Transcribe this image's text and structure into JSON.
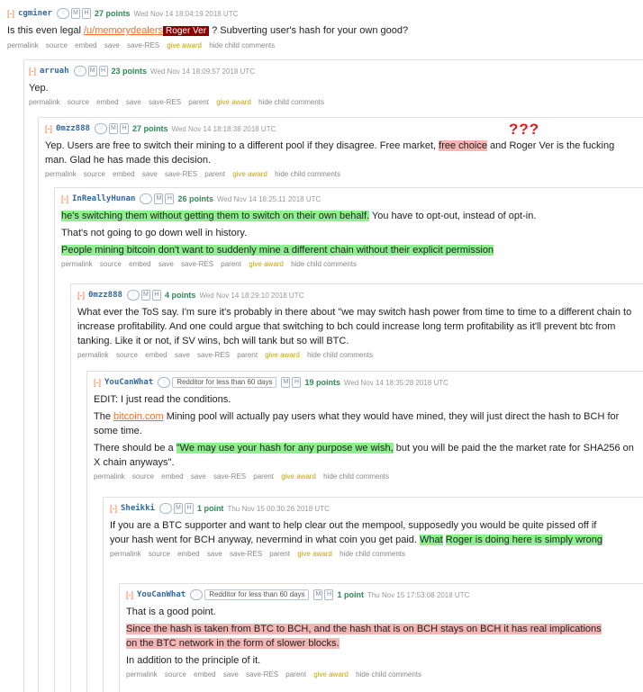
{
  "c1": {
    "toggle": "[-]",
    "author": "cgminer",
    "points": "27 points",
    "date": "Wed Nov 14 18:04:19 2018 UTC",
    "text_pre": "Is this even legal ",
    "user_link": "/u/memorydealers",
    "badge": "Roger Ver",
    "text_post": " ? Subverting user's hash for your own good?",
    "links": [
      "permalink",
      "source",
      "embed",
      "save",
      "save-RES",
      "give award",
      "hide child comments"
    ]
  },
  "c2": {
    "toggle": "[-]",
    "author": "arruah",
    "points": "23 points",
    "date": "Wed Nov 14 18:09:57 2018 UTC",
    "text": "Yep.",
    "links": [
      "permalink",
      "source",
      "embed",
      "save",
      "save-RES",
      "parent",
      "give award",
      "hide child comments"
    ]
  },
  "c3": {
    "toggle": "[-]",
    "author": "0mzz888",
    "points": "27 points",
    "date": "Wed Nov 14 18:18:38 2018 UTC",
    "text_pre": "Yep. Users are free to switch their mining to a different pool if they disagree. Free market, ",
    "hl": "free choice",
    "text_post": " and Roger Ver is the fucking man. Glad he has made this decision.",
    "annotation": "???",
    "links": [
      "permalink",
      "source",
      "embed",
      "save",
      "save-RES",
      "parent",
      "give award",
      "hide child comments"
    ]
  },
  "c4": {
    "toggle": "[-]",
    "author": "InReallyHunan",
    "points": "26 points",
    "date": "Wed Nov 14 18:25:11 2018 UTC",
    "hl1": "he's switching them without getting them to switch on their own behalf.",
    "text1": " You have to opt-out, instead of opt-in.",
    "text2": "That's not going to go down well in history.",
    "hl2": "People mining bitcoin don't want to suddenly mine a different chain without their explicit permission",
    "links": [
      "permalink",
      "source",
      "embed",
      "save",
      "save-RES",
      "parent",
      "give award",
      "hide child comments"
    ]
  },
  "c5": {
    "toggle": "[-]",
    "author": "0mzz888",
    "points": "4 points",
    "date": "Wed Nov 14 18:29:10 2018 UTC",
    "text": "What ever the ToS say. I'm sure it's probably in there about \"we may switch hash power from time to time to a different chain to increase profitability. And one could argue that switching to bch could increase long term profitability as it'll prevent btc from tanking. Like it or not, if SV wins, bch will tank but so will BTC.",
    "links": [
      "permalink",
      "source",
      "embed",
      "save",
      "save-RES",
      "parent",
      "give award",
      "hide child comments"
    ]
  },
  "c6": {
    "toggle": "[-]",
    "author": "YouCanWhat",
    "flair": "Redditor for less than 60 days",
    "points": "19 points",
    "date": "Wed Nov 14 18:35:28 2018 UTC",
    "text1": "EDIT: I just read the conditions.",
    "text2_pre": "The ",
    "link": "bitcoin.com",
    "text2_post": " Mining pool will actually pay users what they would have mined, they will just direct the hash to BCH for some time.",
    "text3_pre": "There should be a ",
    "hl": "\"We may use your hash for any purpose we wish,",
    "text3_post": " but you will be paid the the market rate for SHA256 on X chain anyways\".",
    "links": [
      "permalink",
      "source",
      "embed",
      "save",
      "save-RES",
      "parent",
      "give award",
      "hide child comments"
    ]
  },
  "c7": {
    "toggle": "[-]",
    "author": "Sheikki",
    "points": "1 point",
    "date": "Thu Nov 15 00:30:26 2018 UTC",
    "text_pre": "If you are a BTC supporter and want to help clear out the mempool, supposedly you would be quite pissed off if your hash went for BCH anyway, nevermind in what coin you get paid. ",
    "hl1": "What",
    "hl2": "Roger is doing here is simply wrong",
    "links": [
      "permalink",
      "source",
      "embed",
      "save",
      "save-RES",
      "parent",
      "give award",
      "hide child comments"
    ]
  },
  "c8": {
    "toggle": "[-]",
    "author": "YouCanWhat",
    "flair": "Redditor for less than 60 days",
    "points": "1 point",
    "date": "Thu Nov 15 17:53:08 2018 UTC",
    "text1": "That is a good point.",
    "hl": "Since the hash is taken from BTC to BCH, and the hash that is on BCH stays on BCH it has real implications on the BTC network in the form of slower blocks.",
    "text3": "In addition to the principle of it.",
    "links": [
      "permalink",
      "source",
      "embed",
      "save",
      "save-RES",
      "parent",
      "give award",
      "hide child comments"
    ]
  },
  "colors": {
    "accent": "#ff6a2a",
    "author": "#336699",
    "highlight_green": "#8ff08f",
    "highlight_red": "#f4b5b5",
    "annotation": "#e21b1b",
    "points": "#2e8b57"
  }
}
